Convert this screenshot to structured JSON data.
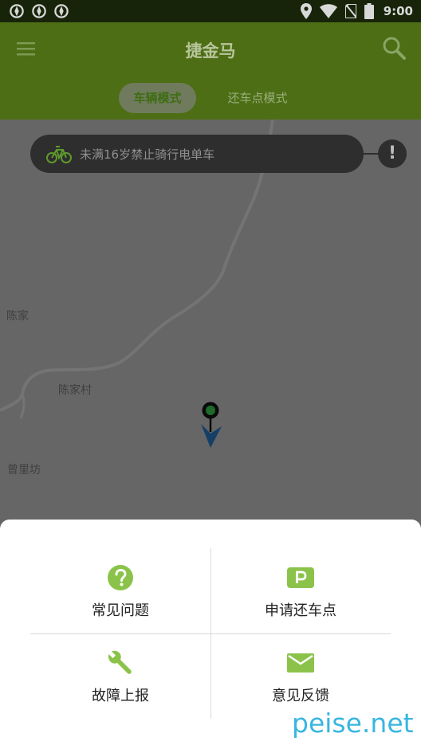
{
  "status_bar": {
    "left_icons": [
      "notification-icon",
      "notification-icon",
      "notification-icon"
    ],
    "right_icons": [
      "location-icon",
      "wifi-icon",
      "no-sim-icon",
      "battery-icon"
    ],
    "time": "9:00"
  },
  "app_bar": {
    "title": "捷金马",
    "menu_icon": "menu-icon",
    "search_icon": "search-icon",
    "tabs": [
      {
        "label": "车辆模式",
        "active": true
      },
      {
        "label": "还车点模式",
        "active": false
      }
    ]
  },
  "map": {
    "notice": {
      "icon": "bike-icon",
      "text": "未满16岁禁止骑行电单车"
    },
    "alert": "!",
    "place_labels": [
      "陈家",
      "陈家村",
      "曾里坊"
    ]
  },
  "sheet": {
    "items": [
      {
        "icon": "help-circle-icon",
        "label": "常见问题"
      },
      {
        "icon": "parking-icon",
        "label": "申请还车点"
      },
      {
        "icon": "wrench-icon",
        "label": "故障上报"
      },
      {
        "icon": "mail-icon",
        "label": "意见反馈"
      }
    ]
  },
  "watermark": "peise.net",
  "colors": {
    "accent_green": "#8bc34a",
    "appbar": "#4d6e15",
    "status_bar": "#172409"
  }
}
